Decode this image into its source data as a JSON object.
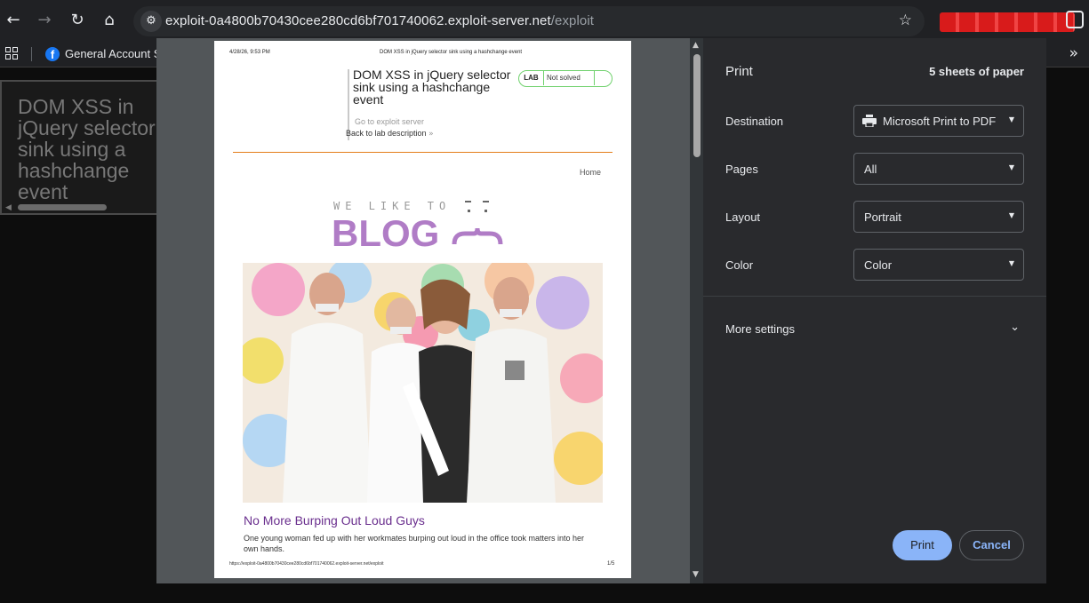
{
  "browser": {
    "url_host": "exploit-0a4800b70430cee280cd6bf701740062.exploit-server.net",
    "url_path": "/exploit",
    "bookmark_label": "General Account Se"
  },
  "underlying_page": {
    "title": "DOM XSS in jQuery selector sink using a hashchange event"
  },
  "preview": {
    "header_date": "4/28/26, 9:53 PM",
    "header_title": "DOM XSS in jQuery selector sink using a hashchange event",
    "lab_title": "DOM XSS in jQuery selector sink using a hashchange event",
    "lab_badge": "LAB",
    "lab_status": "Not solved",
    "go_to_exploit": "Go to exploit server",
    "back_to_lab": "Back to lab description",
    "home_link": "Home",
    "logo_top": "WE LIKE TO",
    "logo_main": "BLOG",
    "post_title": "No More Burping Out Loud Guys",
    "post_description": "One young woman fed up with her workmates burping out loud in the office took matters into her own hands.",
    "footer_url": "https://exploit-0a4800b70430cee280cd6bf701740062.exploit-server.net/exploit",
    "footer_page": "1/5"
  },
  "print_dialog": {
    "title": "Print",
    "sheets": "5 sheets of paper",
    "destination_label": "Destination",
    "destination_value": "Microsoft Print to PDF",
    "pages_label": "Pages",
    "pages_value": "All",
    "layout_label": "Layout",
    "layout_value": "Portrait",
    "color_label": "Color",
    "color_value": "Color",
    "more_settings": "More settings",
    "print_button": "Print",
    "cancel_button": "Cancel"
  },
  "colors": {
    "accent": "#8ab4f8",
    "dialog_bg": "#292a2d",
    "preview_bg": "#525659",
    "lab_badge_border": "#70d16d",
    "blog_purple": "#b07cc6"
  }
}
